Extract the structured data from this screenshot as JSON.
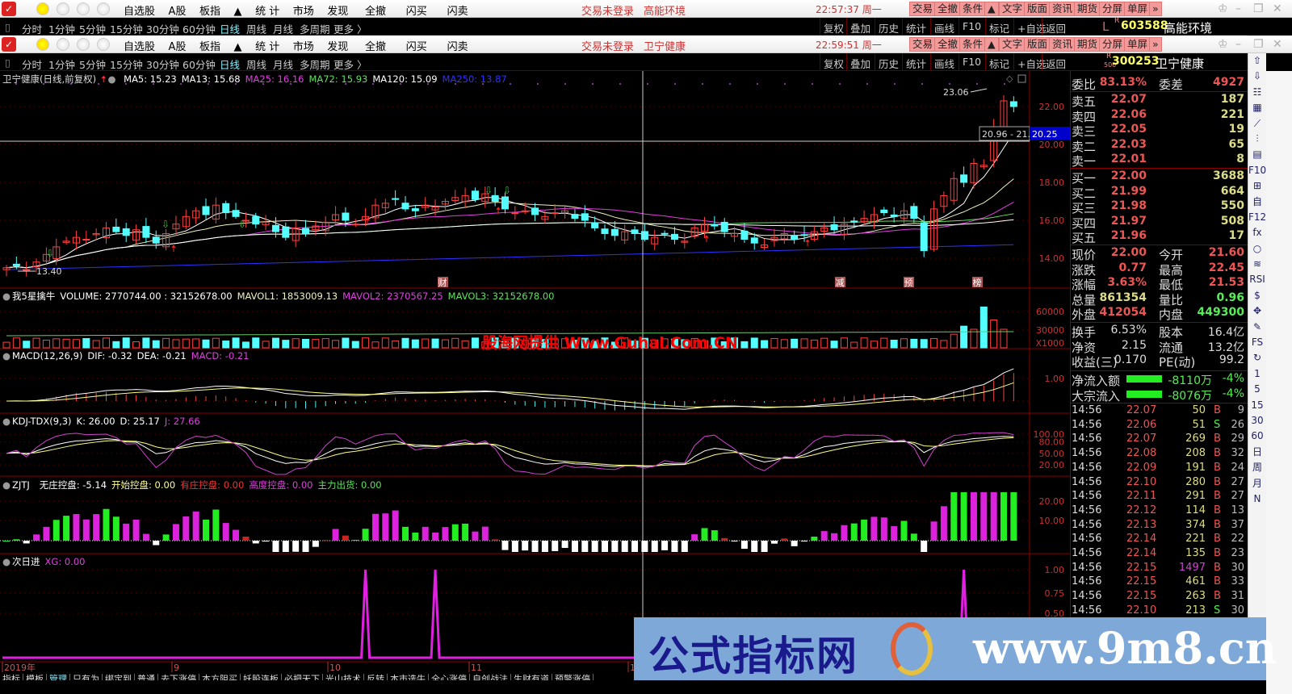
{
  "window1": {
    "title": "高能环境",
    "time": "22:57:37",
    "weekday": "周一",
    "login": "交易未登录",
    "code_prefix": "L",
    "code_flag": "R",
    "code": "603588",
    "name": "高能环境"
  },
  "window2": {
    "title": "卫宁健康",
    "time": "22:59:51",
    "weekday": "周一",
    "login": "交易未登录",
    "code_flag": "R",
    "code_sub": "500",
    "code": "300253",
    "name": "卫宁健康"
  },
  "menu": [
    "自选股",
    "A股",
    "板指",
    "▲",
    "统 计",
    "市场",
    "发现",
    "全撤",
    "闪买",
    "闪卖"
  ],
  "right_buttons": [
    "交易",
    "全撤",
    "条件",
    "▲",
    "文字",
    "版面",
    "资讯",
    "期货",
    "分屏",
    "单屏",
    "»"
  ],
  "periods": [
    "分时",
    "1分钟",
    "5分钟",
    "15分钟",
    "30分钟",
    "60分钟",
    "日线",
    "周线",
    "月线",
    "多周期",
    "更多 〉"
  ],
  "active_period": "日线",
  "tools": [
    "复权",
    "叠加",
    "历史",
    "统计",
    "画线",
    "F10",
    "标记",
    "+自选",
    "返回"
  ],
  "main_header": {
    "title": "卫宁健康(日线,前复权)",
    "ma5": "MA5: 15.23",
    "ma13": "MA13: 15.68",
    "ma25": "MA25: 16.16",
    "ma72": "MA72: 15.93",
    "ma120": "MA120: 15.09",
    "ma250": "MA250: 13.87"
  },
  "price_axis": [
    "22.00",
    "20.00",
    "18.00",
    "16.00",
    "14.00"
  ],
  "cursor_price": "20.25",
  "cursor_range": "20.96 - 21.",
  "high_label": "23.06",
  "low_label": "13.40",
  "event_marks": [
    "财",
    "减",
    "预",
    "榜"
  ],
  "kline": {
    "closes": [
      13.5,
      13.6,
      13.4,
      13.8,
      14.2,
      14.6,
      14.9,
      15.1,
      15.0,
      15.3,
      15.6,
      15.4,
      15.2,
      15.5,
      15.1,
      14.8,
      15.3,
      15.8,
      16.2,
      16.5,
      16.3,
      16.8,
      16.4,
      16.2,
      16.0,
      15.8,
      15.9,
      15.4,
      15.1,
      15.6,
      15.3,
      15.7,
      15.9,
      16.3,
      16.0,
      15.8,
      16.2,
      16.8,
      16.9,
      17.1,
      16.6,
      16.5,
      16.8,
      16.7,
      17.0,
      17.2,
      17.3,
      17.1,
      17.4,
      17.0,
      16.6,
      16.4,
      16.5,
      16.3,
      16.2,
      16.4,
      16.5,
      16.1,
      16.0,
      15.6,
      15.3,
      15.2,
      15.4,
      15.3,
      15.0,
      15.1,
      15.3,
      15.0,
      14.9,
      15.6,
      15.8,
      15.7,
      15.4,
      15.3,
      15.0,
      14.8,
      14.7,
      15.1,
      15.3,
      15.0,
      15.2,
      15.4,
      15.6,
      15.5,
      15.8,
      15.9,
      16.1,
      16.3,
      16.4,
      16.2,
      16.5,
      16.1,
      14.4,
      16.6,
      17.3,
      18.2,
      18.0,
      19.0,
      18.9,
      20.9,
      22.3,
      22.0
    ],
    "colors": {
      "up": "#ff4040",
      "down": "#54ffff",
      "ma5": "#ffffff",
      "ma13": "#f0f0c0",
      "ma25": "#e040e0",
      "ma72": "#60e060",
      "ma120": "#ffffff",
      "ma250": "#3030ff"
    }
  },
  "volume_header": {
    "title": "我5星擒牛",
    "volume": "VOLUME: 2770744.00 : 32152678.00",
    "mavol1": "MAVOL1: 1853009.13",
    "mavol2": "MAVOL2: 2370567.25",
    "mavol3": "MAVOL3: 32152678.00"
  },
  "volume_axis": [
    "60000",
    "30000",
    "X1000"
  ],
  "volume_watermark": "股海网提供 Www.Guhai.Com.CN",
  "macd_header": {
    "title": "MACD(12,26,9)",
    "dif": "DIF: -0.32",
    "dea": "DEA: -0.21",
    "macd": "MACD: -0.21"
  },
  "macd_axis": [
    "1.00"
  ],
  "kdj_header": {
    "title": "KDJ-TDX(9,3)",
    "k": "K: 26.00",
    "d": "D: 25.17",
    "j": "J: 27.66"
  },
  "kdj_axis": [
    "100.00",
    "80.00",
    "50.00",
    "20.00"
  ],
  "zjtj_header": {
    "title": "ZJTJ",
    "a": "无庄控盘: -5.14",
    "b": "开始控盘: 0.00",
    "c": "有庄控盘: 0.00",
    "d": "高度控盘: 0.00",
    "e": "主力出货: 0.00"
  },
  "zjtj_axis": [
    "20.00",
    "10.00"
  ],
  "cry_header": {
    "title": "次日进",
    "xg": "XG: 0.00"
  },
  "cry_axis": [
    "1.00",
    "0.75",
    "0.50"
  ],
  "cry_signal_bars": [
    36,
    43,
    96
  ],
  "date_axis": [
    "2019年",
    "9",
    "10",
    "11",
    "1"
  ],
  "bottom_tabs": [
    "指标",
    "模板",
    "管理",
    "只有为",
    "绑定到",
    "普通",
    "去下涨停",
    "本方阻买",
    "妖股连板",
    "必把天下",
    "光山技术",
    "反转",
    "本市选牛",
    "全心涨停",
    "自创战法",
    "生财有道",
    "预警涨停"
  ],
  "quote": {
    "weibi": {
      "label": "委比",
      "value": "83.13%",
      "label2": "委差",
      "value2": "4927"
    },
    "asks": [
      {
        "label": "卖五",
        "price": "22.07",
        "vol": "187"
      },
      {
        "label": "卖四",
        "price": "22.06",
        "vol": "221"
      },
      {
        "label": "卖三",
        "price": "22.05",
        "vol": "19"
      },
      {
        "label": "卖二",
        "price": "22.03",
        "vol": "65"
      },
      {
        "label": "卖一",
        "price": "22.01",
        "vol": "8"
      }
    ],
    "bids": [
      {
        "label": "买一",
        "price": "22.00",
        "vol": "3688"
      },
      {
        "label": "买二",
        "price": "21.99",
        "vol": "664"
      },
      {
        "label": "买三",
        "price": "21.98",
        "vol": "550"
      },
      {
        "label": "买四",
        "price": "21.97",
        "vol": "508"
      },
      {
        "label": "买五",
        "price": "21.96",
        "vol": "17"
      }
    ],
    "stats": [
      {
        "l1": "现价",
        "v1": "22.00",
        "l2": "今开",
        "v2": "21.60"
      },
      {
        "l1": "涨跌",
        "v1": "0.77",
        "l2": "最高",
        "v2": "22.45"
      },
      {
        "l1": "涨幅",
        "v1": "3.63%",
        "l2": "最低",
        "v2": "21.53"
      },
      {
        "l1": "总量",
        "v1": "861354",
        "l2": "量比",
        "v2": "0.96"
      },
      {
        "l1": "外盘",
        "v1": "412054",
        "l2": "内盘",
        "v2": "449300"
      }
    ],
    "fund": [
      {
        "l1": "换手",
        "v1": "6.53%",
        "l2": "股本",
        "v2": "16.4亿"
      },
      {
        "l1": "净资",
        "v1": "2.15",
        "l2": "流通",
        "v2": "13.2亿"
      },
      {
        "l1": "收益(三)",
        "v1": "0.170",
        "l2": "PE(动)",
        "v2": "99.2"
      }
    ],
    "flows": [
      {
        "label": "净流入额",
        "value": "-8110万",
        "pct": "-4%"
      },
      {
        "label": "大宗流入",
        "value": "-8076万",
        "pct": "-4%"
      }
    ],
    "ticks": [
      [
        "14:56",
        "22.07",
        "50",
        "B",
        "9"
      ],
      [
        "14:56",
        "22.06",
        "51",
        "S",
        "26"
      ],
      [
        "14:56",
        "22.07",
        "269",
        "B",
        "29"
      ],
      [
        "14:56",
        "22.08",
        "208",
        "B",
        "32"
      ],
      [
        "14:56",
        "22.09",
        "191",
        "B",
        "24"
      ],
      [
        "14:56",
        "22.10",
        "280",
        "B",
        "27"
      ],
      [
        "14:56",
        "22.11",
        "291",
        "B",
        "27"
      ],
      [
        "14:56",
        "22.12",
        "114",
        "B",
        "13"
      ],
      [
        "14:56",
        "22.13",
        "374",
        "B",
        "37"
      ],
      [
        "14:56",
        "22.14",
        "221",
        "B",
        "22"
      ],
      [
        "14:56",
        "22.14",
        "135",
        "B",
        "23"
      ],
      [
        "14:56",
        "22.15",
        "1497",
        "B",
        "30"
      ],
      [
        "14:56",
        "22.15",
        "461",
        "B",
        "33"
      ],
      [
        "14:56",
        "22.15",
        "263",
        "B",
        "31"
      ],
      [
        "14:56",
        "22.10",
        "213",
        "S",
        "30"
      ]
    ]
  },
  "side_icons": [
    "⇧",
    "⇩",
    "☷",
    "▦",
    "⟋",
    "⫶",
    "▤",
    "F10",
    "⊞",
    "自",
    "F12",
    "fx",
    "○",
    "≋",
    "RSI",
    "$",
    "✥",
    "✎",
    "FS",
    "↻",
    "1",
    "5",
    "15",
    "30",
    "60",
    "日",
    "周",
    "月",
    "N"
  ],
  "watermark": {
    "text": "公式指标网",
    "url": "www.9m8.cn"
  }
}
